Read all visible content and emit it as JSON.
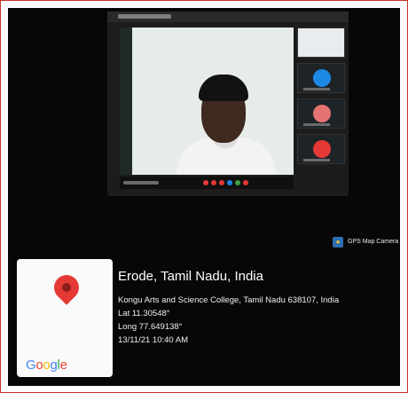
{
  "badge": {
    "text": "GPS Map Camera",
    "icon": "gps-map-camera-icon"
  },
  "location": {
    "city": "Erode, Tamil Nadu, India",
    "address": "Kongu Arts and Science College, Tamil Nadu 638107, India",
    "lat": "Lat 11.30548°",
    "long": "Long 77.649138°",
    "datetime": "13/11/21 10:40 AM"
  },
  "map_logo": {
    "letters": [
      "G",
      "o",
      "o",
      "g",
      "l",
      "e"
    ],
    "colors": [
      "#4285F4",
      "#EA4335",
      "#FBBC05",
      "#4285F4",
      "#34A853",
      "#EA4335"
    ]
  },
  "pin_icon": "map-pin-icon",
  "video_call": {
    "control_button_colors": [
      "#e53935",
      "#e53935",
      "#e53935",
      "#1e88e5",
      "#43a047",
      "#e53935"
    ],
    "participant_tile_colors": [
      "#1e88e5",
      "#e57373",
      "#e53935"
    ]
  }
}
